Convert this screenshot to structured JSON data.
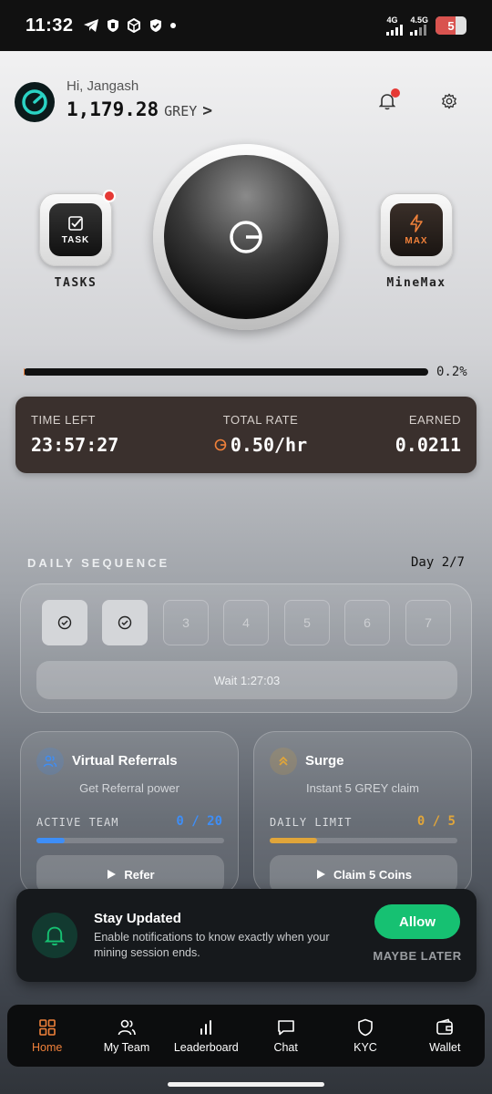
{
  "status_bar": {
    "time": "11:32",
    "network_1": "4G",
    "network_2": "4.5G",
    "battery": "5"
  },
  "header": {
    "greeting": "Hi, Jangash",
    "balance": "1,179.28",
    "unit": "GREY",
    "chevron": ">"
  },
  "mining": {
    "tasks_button_label": "TASK",
    "tasks_caption": "TASKS",
    "minemax_button_label": "MAX",
    "minemax_caption": "MineMax",
    "progress_percent": 0.2,
    "progress_text": "0.2%"
  },
  "stats": {
    "time_left_label": "TIME LEFT",
    "time_left_value": "23:57:27",
    "total_rate_label": "TOTAL RATE",
    "total_rate_value": "0.50/hr",
    "earned_label": "EARNED",
    "earned_value": "0.0211"
  },
  "daily_sequence": {
    "title": "DAILY SEQUENCE",
    "day_indicator": "Day 2/7",
    "days": [
      {
        "label": "",
        "done": true
      },
      {
        "label": "",
        "done": true
      },
      {
        "label": "3",
        "done": false
      },
      {
        "label": "4",
        "done": false
      },
      {
        "label": "5",
        "done": false
      },
      {
        "label": "6",
        "done": false
      },
      {
        "label": "7",
        "done": false
      }
    ],
    "wait_text": "Wait 1:27:03"
  },
  "referrals_card": {
    "title": "Virtual Referrals",
    "subtitle": "Get Referral power",
    "metric_label": "ACTIVE TEAM",
    "metric_value": "0 / 20",
    "fill_fraction": 0.15,
    "button_label": "Refer"
  },
  "surge_card": {
    "title": "Surge",
    "subtitle": "Instant 5 GREY claim",
    "metric_label": "DAILY LIMIT",
    "metric_value": "0 / 5",
    "fill_fraction": 0.25,
    "button_label": "Claim 5 Coins"
  },
  "notification": {
    "title": "Stay Updated",
    "body": "Enable notifications to know exactly when your mining session ends.",
    "allow_label": "Allow",
    "later_label": "MAYBE LATER"
  },
  "nav": {
    "items": [
      {
        "label": "Home",
        "icon": "home-grid-icon",
        "active": true
      },
      {
        "label": "My Team",
        "icon": "team-icon",
        "active": false
      },
      {
        "label": "Leaderboard",
        "icon": "leaderboard-icon",
        "active": false
      },
      {
        "label": "Chat",
        "icon": "chat-icon",
        "active": false
      },
      {
        "label": "KYC",
        "icon": "shield-icon",
        "active": false
      },
      {
        "label": "Wallet",
        "icon": "wallet-icon",
        "active": false
      }
    ]
  },
  "colors": {
    "accent": "#f0813a",
    "allow_green": "#16c172",
    "referral_blue": "#3e8ef7",
    "surge_gold": "#e0a53a",
    "stats_bg": "#3a302d"
  }
}
